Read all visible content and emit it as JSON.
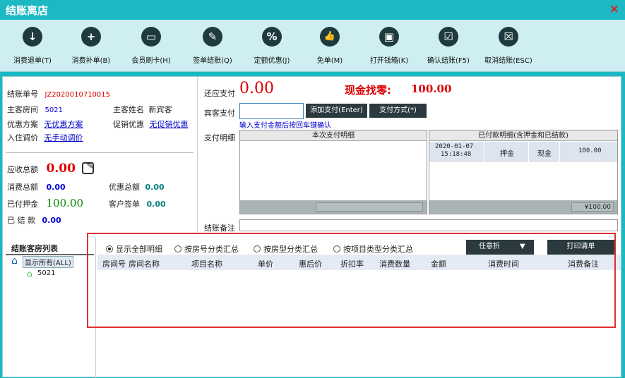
{
  "window": {
    "title": "结账离店",
    "close": "×"
  },
  "toolbar": {
    "items": [
      {
        "label": "消费退单(T)",
        "icon": "↓"
      },
      {
        "label": "消费补单(B)",
        "icon": "+"
      },
      {
        "label": "会员刷卡(H)",
        "icon": "▭"
      },
      {
        "label": "签单结账(Q)",
        "icon": "✎"
      },
      {
        "label": "定额优惠(J)",
        "icon": "%"
      },
      {
        "label": "免单(M)",
        "icon": "👍"
      },
      {
        "label": "打开钱箱(K)",
        "icon": "▣"
      },
      {
        "label": "确认结账(F5)",
        "icon": "☑"
      },
      {
        "label": "取消结账(ESC)",
        "icon": "☒"
      }
    ]
  },
  "info": {
    "bill_no_label": "结账单号",
    "bill_no": "JZ2020010710015",
    "room_label": "主客房间",
    "room": "5021",
    "guest_label": "主客姓名",
    "guest": "新宾客",
    "discount_plan_label": "优惠方案",
    "discount_plan": "无优惠方案",
    "promo_label": "促销优惠",
    "promo": "无促销优惠",
    "checkin_adjust_label": "入住调价",
    "checkin_adjust": "无手动调价",
    "receivable_label": "应收总额",
    "receivable": "0.00",
    "consume_label": "消费总额",
    "consume": "0.00",
    "discount_total_label": "优惠总额",
    "discount_total": "0.00",
    "deposit_label": "已付押金",
    "deposit": "100.00",
    "sign_label": "客户签单",
    "sign": "0.00",
    "settled_label": "已 结 款",
    "settled": "0.00"
  },
  "pay": {
    "due_label": "还应支付",
    "due": "0.00",
    "change_label": "现金找零:",
    "change": "100.00",
    "guest_pay_label": "宾客支付",
    "guest_pay_value": "",
    "add_btn": "添加支付(Enter)",
    "method_btn": "支付方式(*)",
    "hint": "输入支付金额后按回车键确认",
    "detail_label": "支付明细",
    "current_title": "本次支付明细",
    "paid_title": "已付款明细(含押金和已结款)",
    "paid_rows": [
      {
        "date": "2020-01-07",
        "time": "15:18:48",
        "type": "押金",
        "method": "现金",
        "amount": "100.00"
      }
    ],
    "paid_total": "¥100.00",
    "remark_label": "结账备注",
    "remark_value": ""
  },
  "rooms": {
    "title": "结账客房列表",
    "all": "显示所有(ALL)",
    "items": [
      "5021"
    ]
  },
  "detail": {
    "options": [
      "显示全部明细",
      "按房号分类汇总",
      "按房型分类汇总",
      "按项目类型分类汇总"
    ],
    "selected": 0,
    "discount_btn": "任意折",
    "print_btn": "打印清单",
    "columns": [
      "房间号",
      "房间名称",
      "项目名称",
      "单价",
      "惠后价",
      "折扣率",
      "消费数量",
      "金额",
      "消费时间",
      "消费备注"
    ]
  },
  "colors": {
    "accent": "#1cb9c5",
    "red": "#dd0000",
    "blue": "#0000cc",
    "green": "#008800"
  }
}
